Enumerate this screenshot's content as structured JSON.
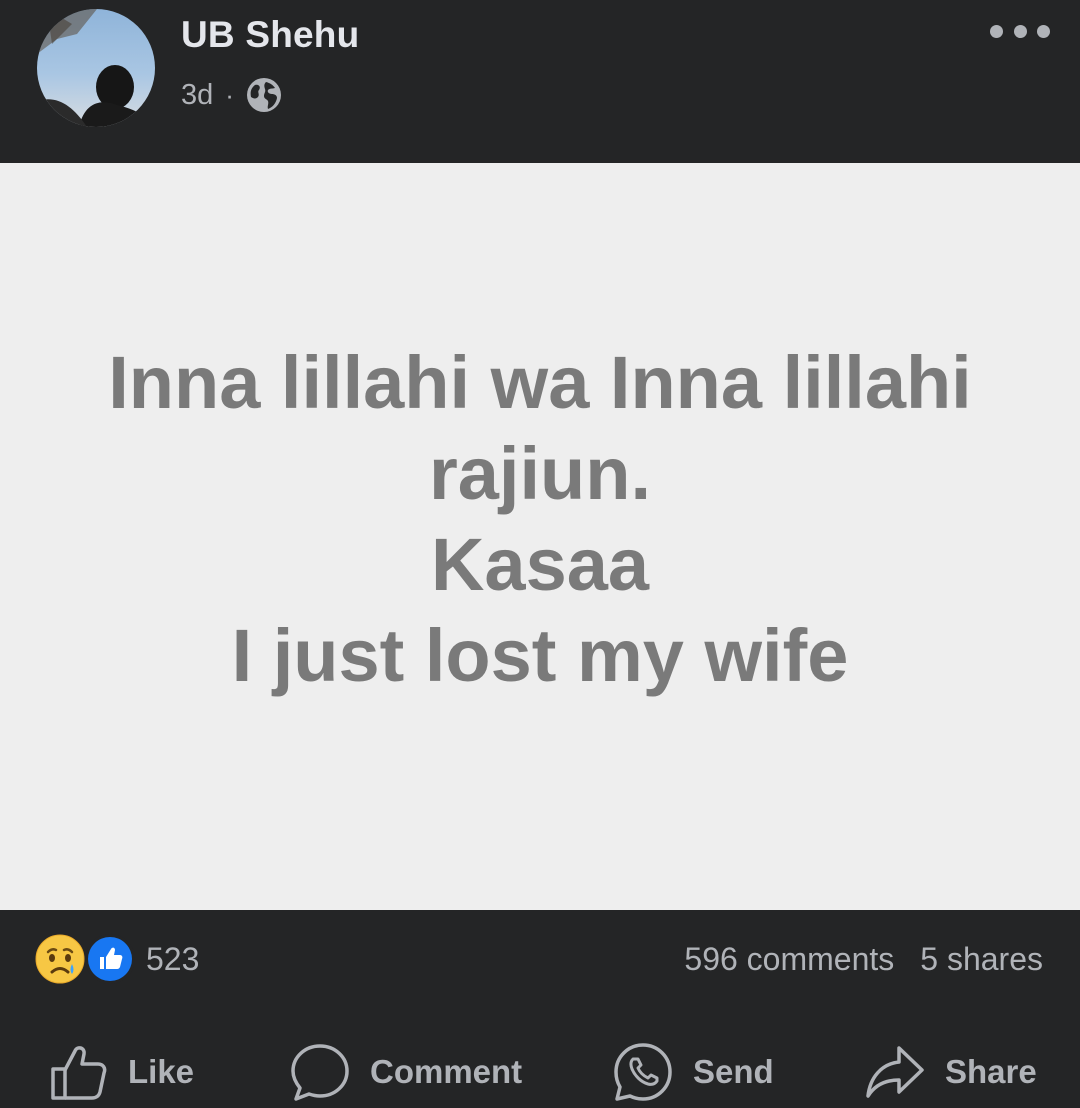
{
  "post": {
    "author": "UB Shehu",
    "time": "3d",
    "separator": "·",
    "privacy_icon": "globe-icon",
    "more_icon": "more-horizontal-icon",
    "text_lines": [
      "Inna lillahi wa Inna lillahi",
      "rajiun.",
      "Kasaa",
      "I just lost my wife"
    ]
  },
  "reactions": {
    "icons": [
      "sad-reaction-icon",
      "like-reaction-icon"
    ],
    "count": "523",
    "comments": "596 comments",
    "shares": "5 shares"
  },
  "actions": {
    "like": "Like",
    "comment": "Comment",
    "send": "Send",
    "share": "Share"
  },
  "colors": {
    "background": "#242526",
    "post_background": "#eeeeee",
    "post_text": "#7a7a7a",
    "primary_text": "#e4e6eb",
    "secondary_text": "#b0b3b8",
    "like_blue": "#1877f2"
  }
}
